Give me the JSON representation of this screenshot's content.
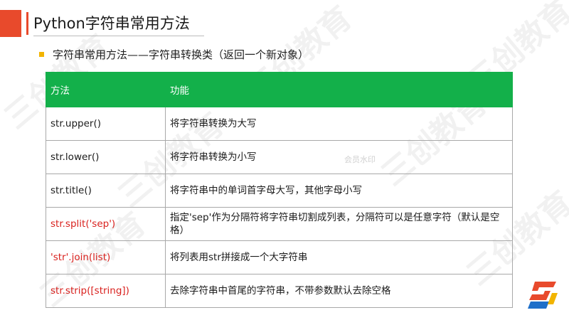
{
  "header": {
    "title": "Python字符串常用方法"
  },
  "subtitle": "字符串常用方法——字符串转换类（返回一个新对象）",
  "table": {
    "headers": [
      "方法",
      "功能"
    ],
    "rows": [
      {
        "method": "str.upper()",
        "desc": "将字符串转换为大写"
      },
      {
        "method": "str.lower()",
        "desc": "将字符串转换为小写"
      },
      {
        "method": "str.title()",
        "desc": "将字符串中的单词首字母大写，其他字母小写"
      },
      {
        "method": "str.split('sep')",
        "desc": "指定'sep'作为分隔符将字符串切割成列表，分隔符可以是任意字符（默认是空格）"
      },
      {
        "method": "'str'.join(list)",
        "desc": "将列表用str拼接成一个大字符串"
      },
      {
        "method": "str.strip([string])",
        "desc": "去除字符串中首尾的字符串，不带参数默认去除空格"
      }
    ]
  },
  "watermark": {
    "text": "三创教育",
    "small_text": "会员水印"
  },
  "colors": {
    "accent_red": "#e84a2c",
    "header_green": "#13b04a",
    "bullet_yellow": "#f2b400",
    "method_red": "#d9211e"
  }
}
